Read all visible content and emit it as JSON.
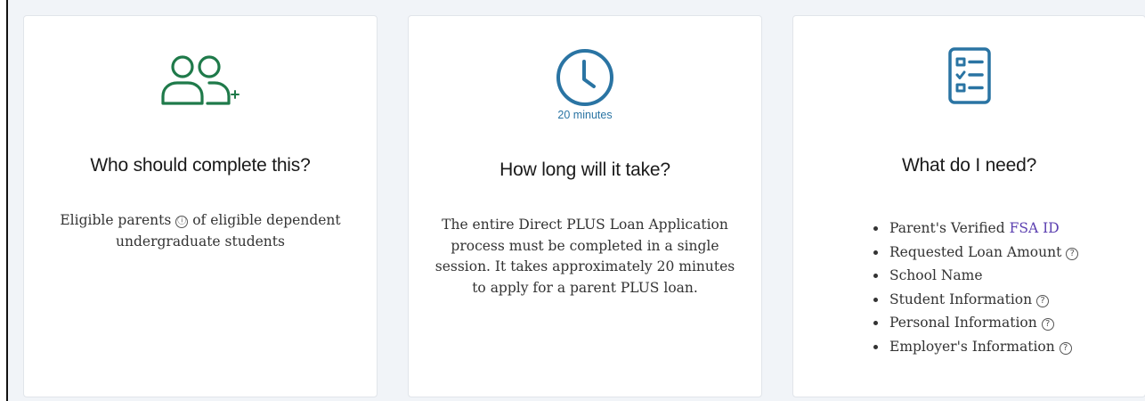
{
  "cards": [
    {
      "icon": "add-user-icon",
      "icon_color": "#1f7a4a",
      "heading": "Who should complete this?",
      "body": {
        "part1": "Eligible parents",
        "info_icon": "ⓘ",
        "part2": "of eligible dependent undergraduate students"
      }
    },
    {
      "icon": "clock-icon",
      "icon_color": "#2a74a3",
      "duration": "20 minutes",
      "heading": "How long will it take?",
      "body": "The entire Direct PLUS Loan Application process must be completed in a single session. It takes approximately 20 minutes to apply for a parent PLUS loan."
    },
    {
      "icon": "checklist-icon",
      "icon_color": "#2a74a3",
      "heading": "What do I need?",
      "items": [
        {
          "prefix": "Parent's Verified ",
          "link": "FSA ID"
        },
        {
          "text": "Requested Loan Amount",
          "help": "?"
        },
        {
          "text": "School Name"
        },
        {
          "text": "Student Information",
          "help": "?"
        },
        {
          "text": "Personal Information",
          "help": "?"
        },
        {
          "text": "Employer's Information",
          "help": "?"
        }
      ]
    }
  ],
  "colors": {
    "link": "#5b3fb0",
    "background": "#f1f4f8",
    "card": "#ffffff"
  }
}
